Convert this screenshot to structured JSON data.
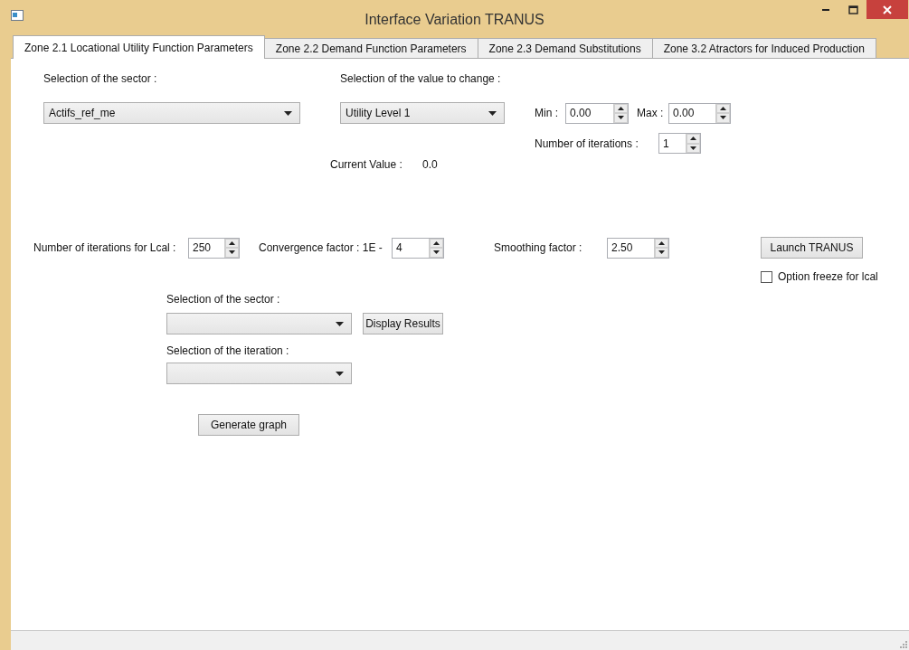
{
  "window": {
    "title": "Interface Variation TRANUS"
  },
  "tabs": [
    {
      "label": "Zone 2.1 Locational Utility Function Parameters",
      "selected": true
    },
    {
      "label": "Zone 2.2 Demand Function Parameters",
      "selected": false
    },
    {
      "label": "Zone 2.3 Demand Substitutions",
      "selected": false
    },
    {
      "label": "Zone 3.2 Atractors for Induced Production",
      "selected": false
    }
  ],
  "sector_selection": {
    "label": "Selection of the sector :",
    "value": "Actifs_ref_me"
  },
  "value_selection": {
    "label": "Selection of the value to change :",
    "value": "Utility Level 1"
  },
  "min": {
    "label": "Min :",
    "value": "0.00"
  },
  "max": {
    "label": "Max :",
    "value": "0.00"
  },
  "iterations": {
    "label": "Number of iterations :",
    "value": "1"
  },
  "current_value": {
    "label": "Current Value :",
    "value": "0.0"
  },
  "lcal_iterations": {
    "label": "Number of iterations for Lcal :",
    "value": "250"
  },
  "convergence": {
    "label": "Convergence factor : 1E -",
    "value": "4"
  },
  "smoothing": {
    "label": "Smoothing factor :",
    "value": "2.50"
  },
  "launch_button": "Launch TRANUS",
  "freeze_option": {
    "label": "Option freeze for lcal",
    "checked": false
  },
  "results": {
    "sector_label": "Selection of the sector :",
    "display_button": "Display Results",
    "iteration_label": "Selection of the iteration :",
    "graph_button": "Generate graph"
  }
}
